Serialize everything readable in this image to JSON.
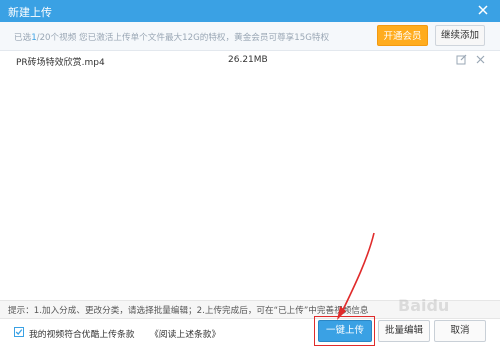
{
  "window": {
    "title": "新建上传"
  },
  "info": {
    "prefix": "已选",
    "selected": "1",
    "suffix": "/20个视频  您已激活上传单个文件最大12G的特权，黄金会员可尊享15G特权"
  },
  "buttons": {
    "vip": "开通会员",
    "continue_add": "继续添加",
    "upload": "一键上传",
    "batch_edit": "批量编辑",
    "cancel": "取消"
  },
  "file": {
    "name": "PR砖场特效欣赏.mp4",
    "size": "26.21MB"
  },
  "tip": "提示：1.加入分成、更改分类，请选择批量编辑；2.上传完成后，可在“已上传”中完善视频信息",
  "agreement": {
    "label": "我的视频符合优酷上传条款",
    "link": "《阅读上述条款》",
    "checked": true
  },
  "watermark": "Baidu",
  "colors": {
    "accent": "#3aa1e4",
    "vip": "#ffac1e",
    "highlight": "#e02b2b"
  },
  "icons": [
    "close-icon",
    "edit-icon",
    "delete-icon",
    "checkbox-checked-icon",
    "annotation-arrow"
  ]
}
